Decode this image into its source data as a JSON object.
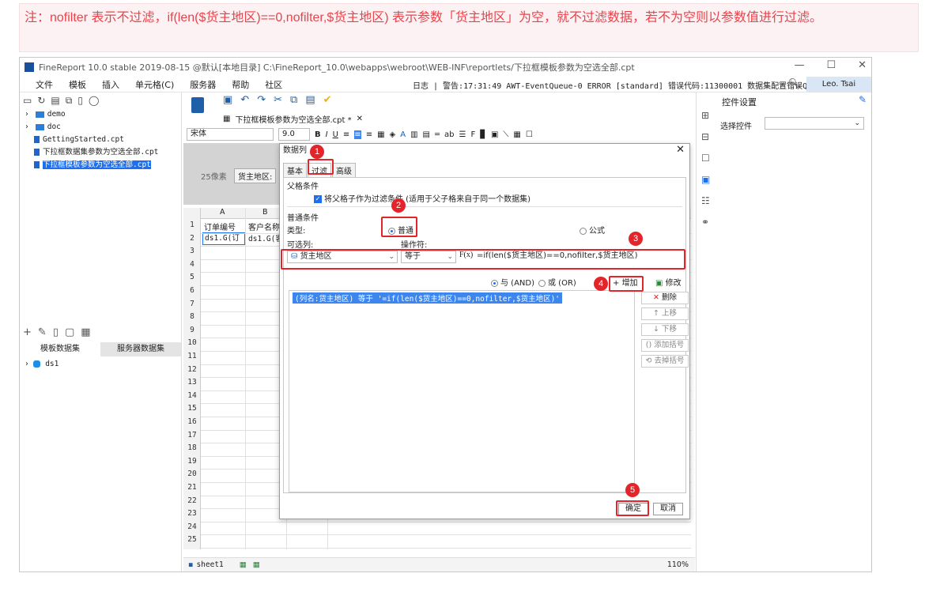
{
  "note": "注：nofilter 表示不过滤，if(len($货主地区)==0,nofilter,$货主地区) 表示参数「货主地区」为空，就不过滤数据，若不为空则以参数值进行过滤。",
  "window": {
    "title": "FineReport 10.0 stable 2019-08-15 @默认[本地目录]   C:\\FineReport_10.0\\webapps\\webroot\\WEB-INF\\reportlets/下拉框模板参数为空选全部.cpt",
    "controls": [
      "—",
      "☐",
      "✕"
    ]
  },
  "menubar": {
    "items": [
      "文件",
      "模板",
      "插入",
      "单元格(C)",
      "服务器",
      "帮助",
      "社区"
    ],
    "log": "日志 | 警告:17:31:49 AWT-EventQueue-0 ERROR [standard] 错误代码:11300001 数据集配置错误Query:java...",
    "user": "Leo. Tsai"
  },
  "tree": {
    "items": [
      {
        "label": "demo",
        "type": "folder"
      },
      {
        "label": "doc",
        "type": "folder"
      },
      {
        "label": "GettingStarted.cpt",
        "type": "file"
      },
      {
        "label": "下拉框数据集参数为空选全部.cpt",
        "type": "file"
      },
      {
        "label": "下拉框模板参数为空选全部.cpt",
        "type": "file",
        "selected": true
      }
    ]
  },
  "dataset_tabs": {
    "template": "模板数据集",
    "server": "服务器数据集"
  },
  "dataset_item": "ds1",
  "editor": {
    "file_tab": "下拉框模板参数为空选全部.cpt *",
    "font_name": "宋体",
    "font_size": "9.0",
    "param_hint": "25像素",
    "param_label": "货主地区:",
    "col_a": "A",
    "col_b": "B",
    "header_a": "订单编号",
    "header_b": "客户名称",
    "cell_a2": "ds1.G(订",
    "cell_b2": "ds1.G(客",
    "rows": [
      "1",
      "2",
      "3",
      "4",
      "5",
      "6",
      "7",
      "8",
      "9",
      "10",
      "11",
      "12",
      "13",
      "14",
      "15",
      "16",
      "17",
      "18",
      "19",
      "20",
      "21",
      "22",
      "23",
      "24",
      "25"
    ],
    "sheet": "sheet1",
    "zoom": "110%"
  },
  "right_panel": {
    "title": "控件设置",
    "select_label": "选择控件"
  },
  "dialog": {
    "title": "数据列",
    "tabs": [
      "基本",
      "过滤",
      "高级"
    ],
    "parent_section": "父格条件",
    "parent_checkbox": "将父格子作为过滤条件 (适用于父子格来自于同一个数据集)",
    "normal_section": "普通条件",
    "type_label": "类型:",
    "type_normal": "普通",
    "type_formula": "公式",
    "col_label": "可选列:",
    "op_label": "操作符:",
    "col_value": "货主地区",
    "op_value": "等于",
    "formula_value": "=if(len($货主地区)==0,nofilter,$货主地区)",
    "and_label": "与 (AND)",
    "or_label": "或 (OR)",
    "add_btn": "增加",
    "modify_btn": "修改",
    "condition": "(列名:货主地区) 等于 '=if(len($货主地区)==0,nofilter,$货主地区)'",
    "side_buttons": [
      "删除",
      "上移",
      "下移",
      "添加括号",
      "去掉括号"
    ],
    "ok": "确定",
    "cancel": "取消"
  },
  "badges": [
    "1",
    "2",
    "3",
    "4",
    "5"
  ]
}
